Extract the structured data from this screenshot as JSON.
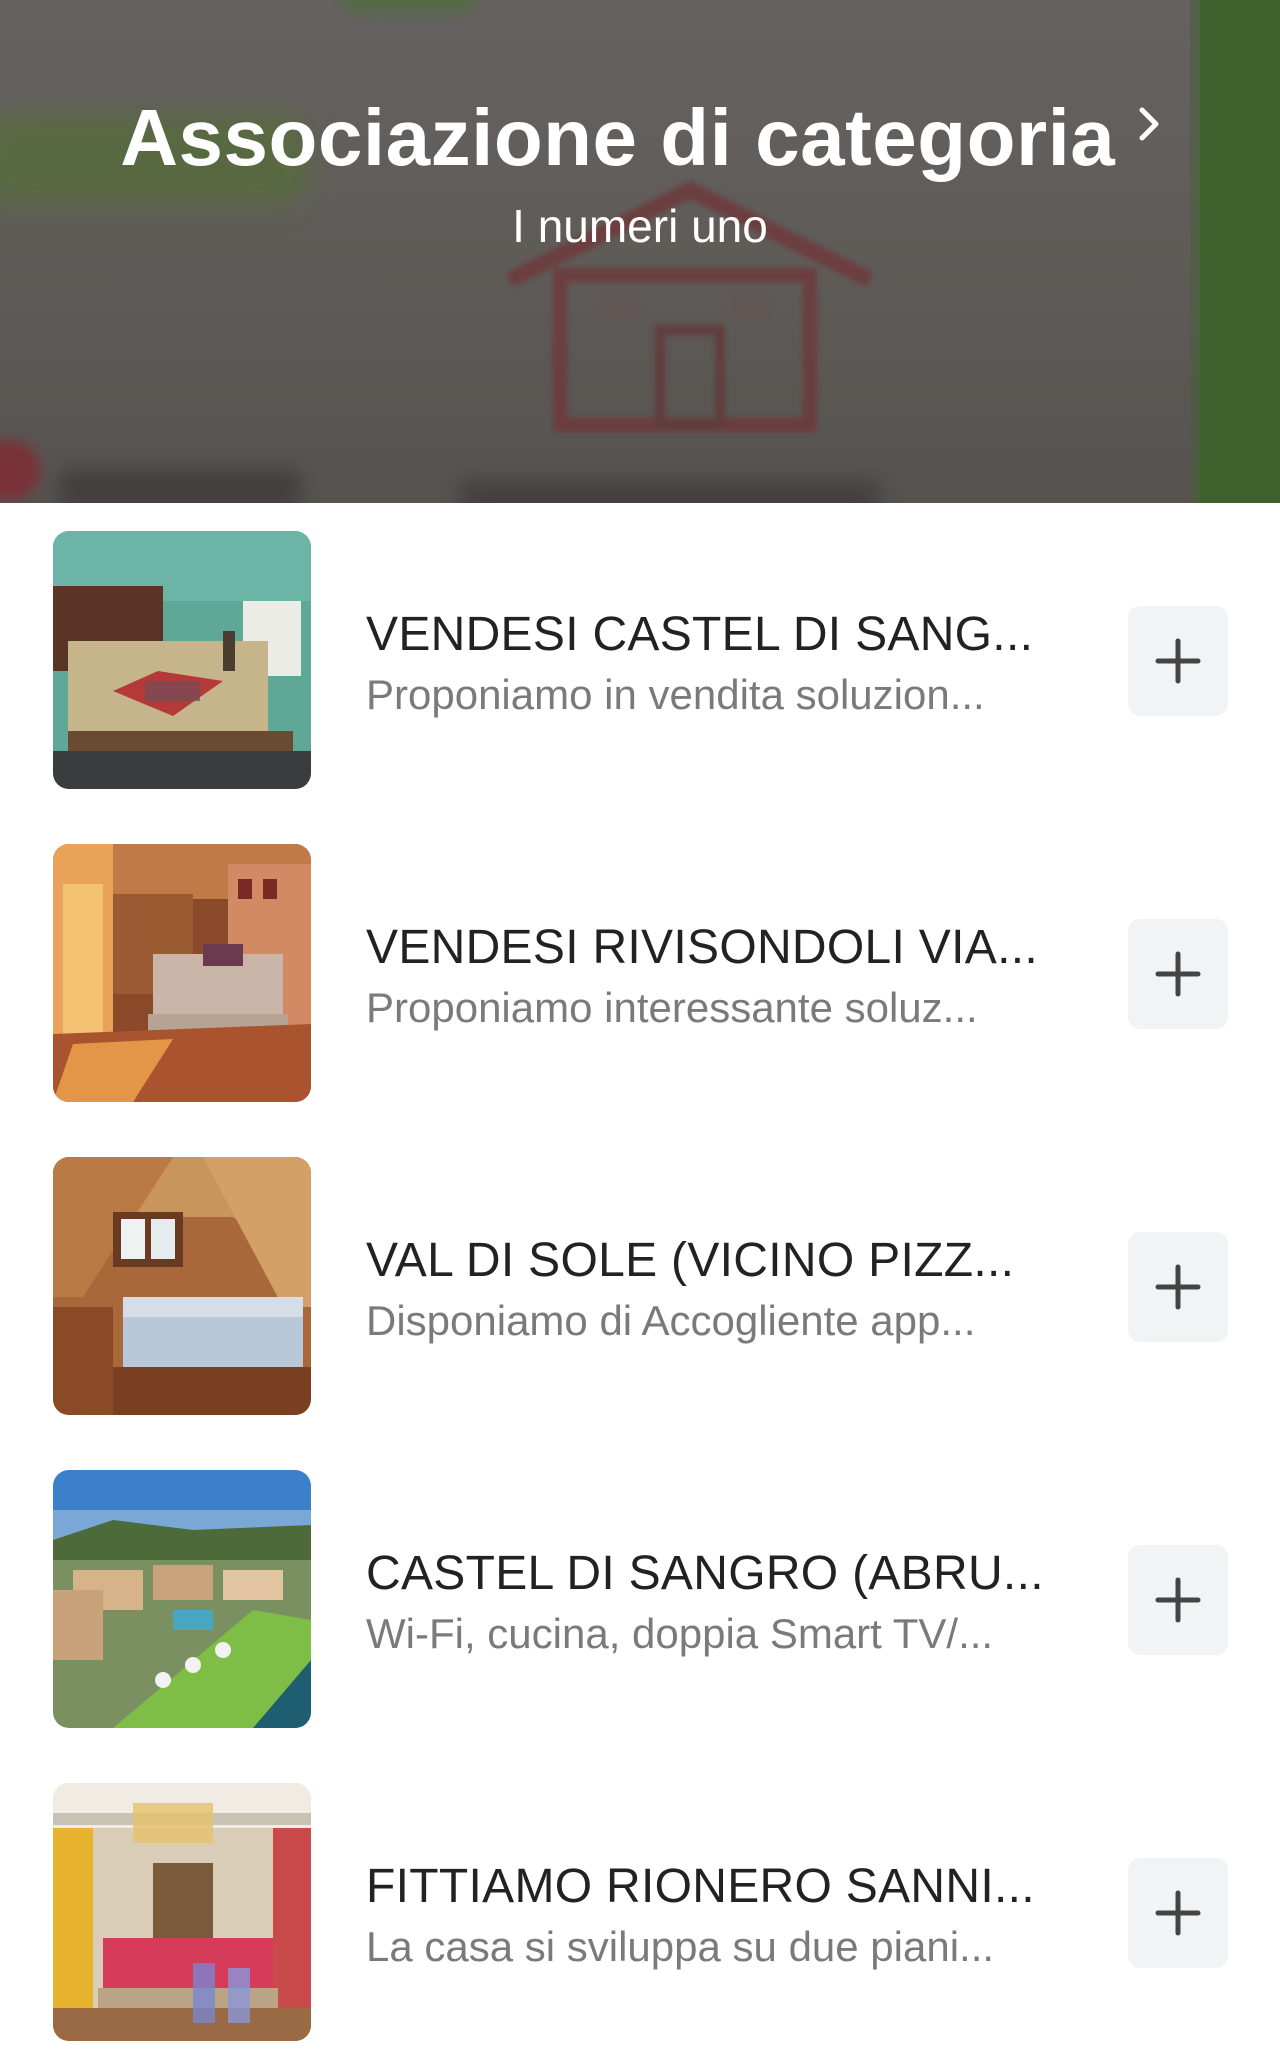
{
  "header": {
    "title": "Associazione di categoria",
    "subtitle": "I numeri uno"
  },
  "icons": {
    "chevron": "chevron-right-icon",
    "add": "plus-icon"
  },
  "items": [
    {
      "title": "VENDESI CASTEL DI SANG...",
      "description": "Proponiamo in vendita soluzion...",
      "image": "bedroom-turquoise-wall-photo"
    },
    {
      "title": "VENDESI RIVISONDOLI VIA...",
      "description": "Proponiamo interessante soluz...",
      "image": "living-room-wood-sofa-photo"
    },
    {
      "title": "VAL DI SOLE (VICINO PIZZ...",
      "description": "Disponiamo di Accogliente app...",
      "image": "attic-bedroom-wood-photo"
    },
    {
      "title": "CASTEL DI SANGRO (ABRU...",
      "description": "Wi-Fi, cucina, doppia Smart TV/...",
      "image": "aerial-town-river-photo"
    },
    {
      "title": "FITTIAMO RIONERO SANNI...",
      "description": "La casa si sviluppa su due piani...",
      "image": "interior-chandelier-photo"
    }
  ]
}
